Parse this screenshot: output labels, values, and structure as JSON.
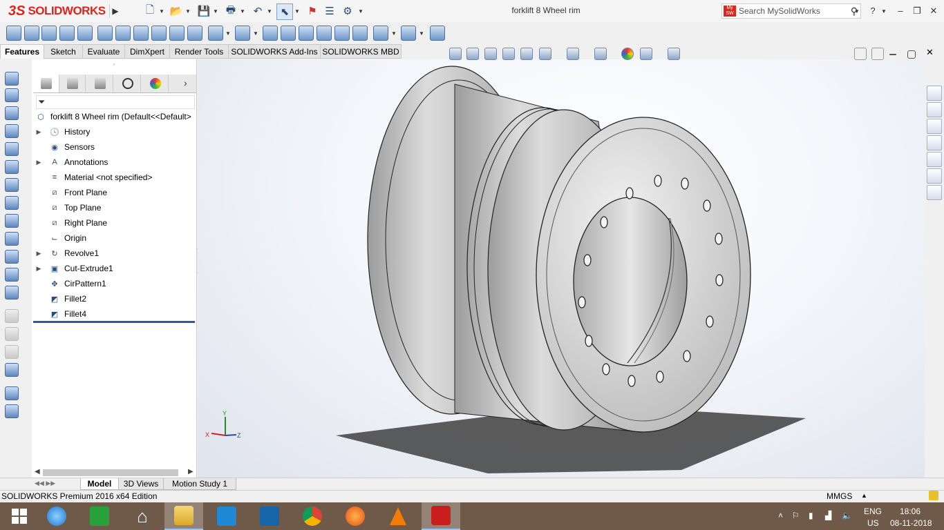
{
  "app": {
    "logo_ds": "3S",
    "logo_text": "SOLIDWORKS",
    "document_title": "forklift 8 Wheel rim"
  },
  "search": {
    "placeholder": "Search MySolidWorks",
    "badge": "My SW"
  },
  "window_controls": {
    "help": "?",
    "minimize": "–",
    "restore": "❐",
    "close": "✕"
  },
  "tabs": [
    {
      "label": "Features",
      "active": true
    },
    {
      "label": "Sketch"
    },
    {
      "label": "Evaluate"
    },
    {
      "label": "DimXpert"
    },
    {
      "label": "Render Tools"
    },
    {
      "label": "SOLIDWORKS Add-Ins"
    },
    {
      "label": "SOLIDWORKS MBD"
    }
  ],
  "feature_tree": {
    "root": "forklift 8 Wheel rim  (Default<<Default>",
    "items": [
      {
        "label": "History",
        "icon": "history-icon",
        "expandable": true
      },
      {
        "label": "Sensors",
        "icon": "sensors-icon",
        "expandable": false
      },
      {
        "label": "Annotations",
        "icon": "annotations-icon",
        "expandable": true
      },
      {
        "label": "Material <not specified>",
        "icon": "material-icon",
        "expandable": false
      },
      {
        "label": "Front Plane",
        "icon": "plane-icon",
        "expandable": false
      },
      {
        "label": "Top Plane",
        "icon": "plane-icon",
        "expandable": false
      },
      {
        "label": "Right Plane",
        "icon": "plane-icon",
        "expandable": false
      },
      {
        "label": "Origin",
        "icon": "origin-icon",
        "expandable": false
      },
      {
        "label": "Revolve1",
        "icon": "revolve-icon",
        "expandable": true
      },
      {
        "label": "Cut-Extrude1",
        "icon": "cut-extrude-icon",
        "expandable": true
      },
      {
        "label": "CirPattern1",
        "icon": "circular-pattern-icon",
        "expandable": false
      },
      {
        "label": "Fillet2",
        "icon": "fillet-icon",
        "expandable": false
      },
      {
        "label": "Fillet4",
        "icon": "fillet-icon",
        "expandable": false
      }
    ]
  },
  "triad": {
    "x": "X",
    "y": "Y",
    "z": "Z"
  },
  "bottom_tabs": [
    {
      "label": "Model",
      "active": true
    },
    {
      "label": "3D Views"
    },
    {
      "label": "Motion Study 1"
    }
  ],
  "status": {
    "text": "SOLIDWORKS Premium 2016 x64 Edition",
    "units": "MMGS"
  },
  "taskbar": {
    "apps": [
      "start",
      "internet-explorer",
      "store",
      "home",
      "file-explorer",
      "mail",
      "lenovo",
      "chrome",
      "firefox",
      "vlc",
      "solidworks"
    ],
    "lang_line1": "ENG",
    "lang_line2": "US",
    "time": "18:06",
    "date": "08-11-2018"
  },
  "colors": {
    "brand": "#e2231a",
    "taskbar": "#6f5a4a",
    "accent": "#2c5aa0"
  }
}
